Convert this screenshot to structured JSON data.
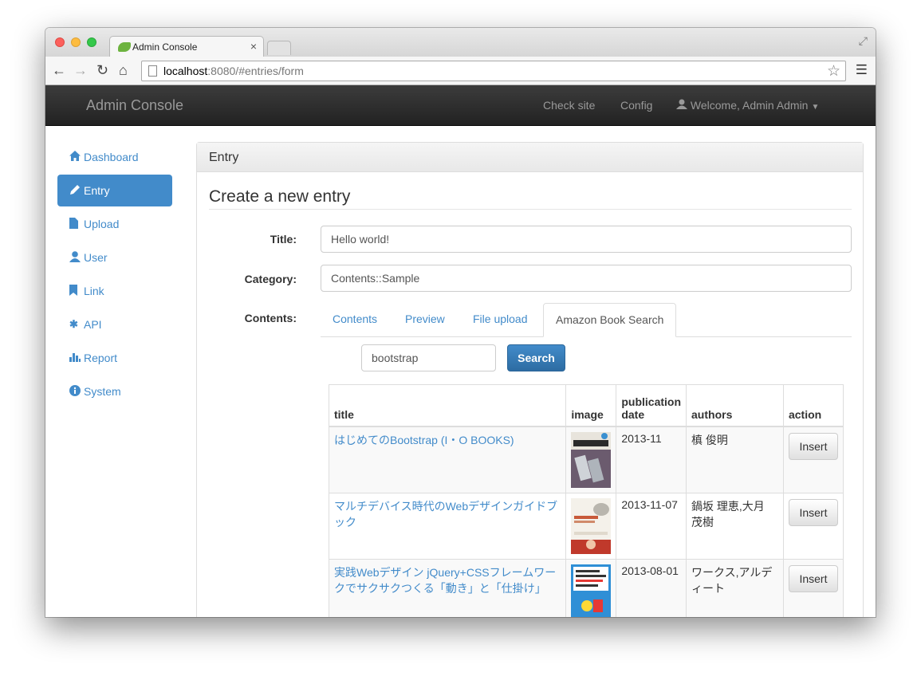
{
  "browser": {
    "tab_title": "Admin Console",
    "tab_close": "×",
    "url_host": "localhost",
    "url_rest": ":8080/#entries/form"
  },
  "navbar": {
    "brand": "Admin Console",
    "links": {
      "check_site": "Check site",
      "config": "Config",
      "user": "Welcome, Admin Admin"
    }
  },
  "sidebar": {
    "items": [
      {
        "label": "Dashboard",
        "icon": "home-icon",
        "active": false
      },
      {
        "label": "Entry",
        "icon": "pencil-icon",
        "active": true
      },
      {
        "label": "Upload",
        "icon": "file-icon",
        "active": false
      },
      {
        "label": "User",
        "icon": "user-icon",
        "active": false
      },
      {
        "label": "Link",
        "icon": "bookmark-icon",
        "active": false
      },
      {
        "label": "API",
        "icon": "asterisk-icon",
        "active": false
      },
      {
        "label": "Report",
        "icon": "stats-icon",
        "active": false
      },
      {
        "label": "System",
        "icon": "info-icon",
        "active": false
      }
    ]
  },
  "panel": {
    "heading": "Entry",
    "legend": "Create a new entry",
    "form": {
      "title_label": "Title:",
      "title_value": "Hello world!",
      "category_label": "Category:",
      "category_value": "Contents::Sample",
      "contents_label": "Contents:"
    },
    "tabs": [
      {
        "label": "Contents",
        "active": false
      },
      {
        "label": "Preview",
        "active": false
      },
      {
        "label": "File upload",
        "active": false
      },
      {
        "label": "Amazon Book Search",
        "active": true
      }
    ],
    "search": {
      "value": "bootstrap",
      "button": "Search"
    },
    "table": {
      "headers": {
        "title": "title",
        "image": "image",
        "date": "publication date",
        "authors": "authors",
        "action": "action"
      },
      "rows": [
        {
          "title": "はじめてのBootstrap (I・O BOOKS)",
          "date": "2013-11",
          "authors": "槙 俊明",
          "action": "Insert"
        },
        {
          "title": "マルチデバイス時代のWebデザインガイドブック",
          "date": "2013-11-07",
          "authors": "鍋坂 理恵,大月 茂樹",
          "action": "Insert"
        },
        {
          "title": "実践Webデザイン jQuery+CSSフレームワークでサクサクつくる「動き」と「仕掛け」",
          "date": "2013-08-01",
          "authors": "ワークス,アルディート",
          "action": "Insert"
        }
      ]
    }
  },
  "colors": {
    "primary": "#428bca",
    "navbar": "#222222"
  }
}
